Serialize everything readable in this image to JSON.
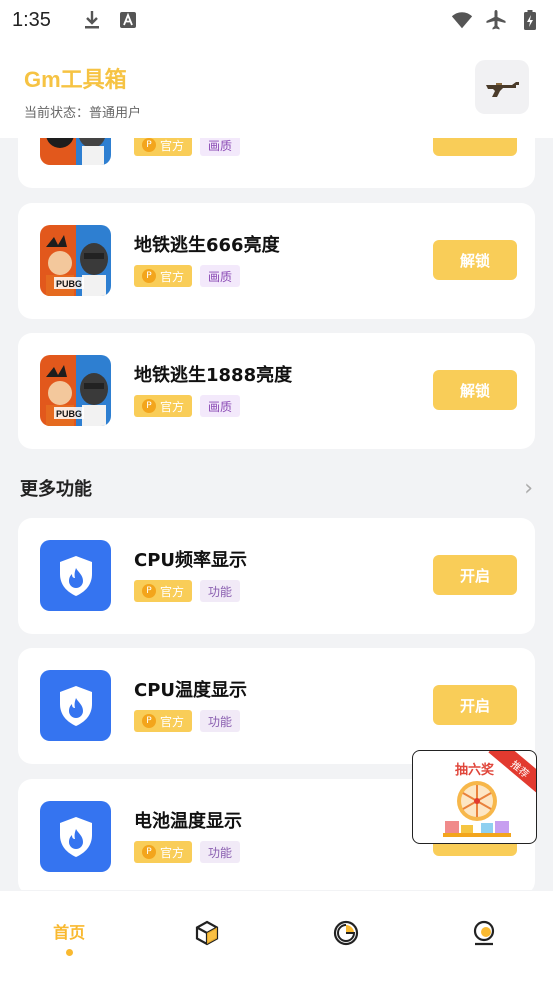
{
  "status_bar": {
    "time": "1:35"
  },
  "header": {
    "title": "Gm工具箱",
    "status": "当前状态：普通用户"
  },
  "cards_top": [
    {
      "title": "地铁逃生666亮度",
      "tag_official": "官方",
      "tag_category": "画质",
      "button": "解锁"
    },
    {
      "title": "地铁逃生1888亮度",
      "tag_official": "官方",
      "tag_category": "画质",
      "button": "解锁"
    }
  ],
  "partial_card": {
    "tag_official": "官方",
    "tag_category": "画质"
  },
  "section": {
    "title": "更多功能"
  },
  "cards_more": [
    {
      "title": "CPU频率显示",
      "tag_official": "官方",
      "tag_category": "功能",
      "button": "开启"
    },
    {
      "title": "CPU温度显示",
      "tag_official": "官方",
      "tag_category": "功能",
      "button": "开启"
    },
    {
      "title": "电池温度显示",
      "tag_official": "官方",
      "tag_category": "功能",
      "button": "开启"
    }
  ],
  "promo": {
    "text": "抽六奖",
    "ribbon": "推荐"
  },
  "bottom_nav": {
    "home_label": "首页"
  },
  "colors": {
    "accent": "#f9cd58",
    "blue": "#3574f0"
  }
}
